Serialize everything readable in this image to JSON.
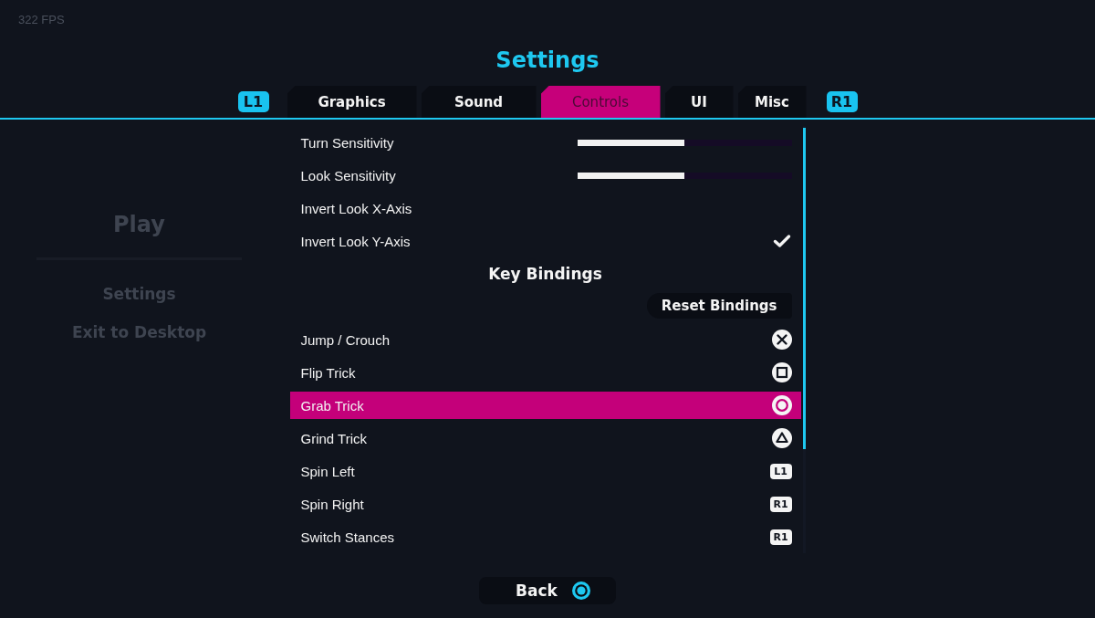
{
  "background": {
    "fps": "322 FPS",
    "menu": [
      {
        "label": "Play"
      },
      {
        "label": "Settings"
      },
      {
        "label": "Exit to Desktop"
      }
    ]
  },
  "title": "Settings",
  "tabs": {
    "prev_key": "L1",
    "next_key": "R1",
    "items": [
      {
        "label": "Graphics",
        "selected": false
      },
      {
        "label": "Sound",
        "selected": false
      },
      {
        "label": "Controls",
        "selected": true
      },
      {
        "label": "UI",
        "selected": false
      },
      {
        "label": "Misc",
        "selected": false
      }
    ]
  },
  "settings": [
    {
      "kind": "slider",
      "label": "Turn Sensitivity",
      "level": 0.5
    },
    {
      "kind": "slider",
      "label": "Look Sensitivity",
      "level": 0.5
    },
    {
      "kind": "toggle",
      "label": "Invert Look X-Axis",
      "checked": false
    },
    {
      "kind": "toggle",
      "label": "Invert Look Y-Axis",
      "checked": true
    }
  ],
  "key_bindings": {
    "heading": "Key Bindings",
    "reset_button": "Reset Bindings",
    "items": [
      {
        "action": "Jump / Crouch",
        "button": {
          "kind": "cross"
        },
        "selected": false
      },
      {
        "action": "Flip Trick",
        "button": {
          "kind": "square"
        },
        "selected": false
      },
      {
        "action": "Grab Trick",
        "button": {
          "kind": "circle"
        },
        "selected": true
      },
      {
        "action": "Grind Trick",
        "button": {
          "kind": "triangle"
        },
        "selected": false
      },
      {
        "action": "Spin Left",
        "button": {
          "kind": "shoulder",
          "label": "L1"
        },
        "selected": false
      },
      {
        "action": "Spin Right",
        "button": {
          "kind": "shoulder",
          "label": "R1"
        },
        "selected": false
      },
      {
        "action": "Switch Stances",
        "button": {
          "kind": "shoulder",
          "label": "R1"
        },
        "selected": false
      }
    ]
  },
  "back_button": {
    "label": "Back"
  }
}
